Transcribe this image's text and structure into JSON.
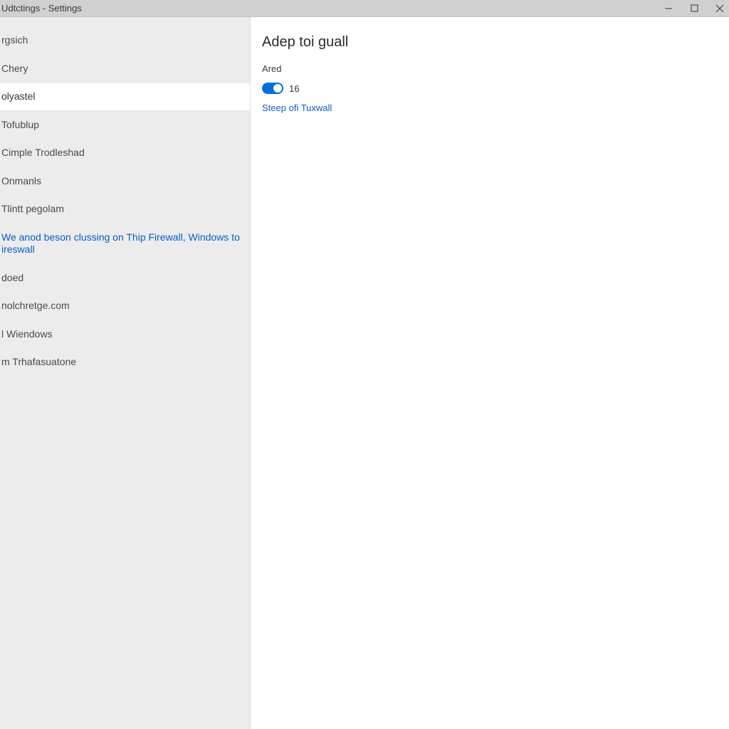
{
  "titlebar": {
    "title": "Udtctings  -  Settings"
  },
  "sidebar": {
    "items": [
      {
        "label": "rgsich",
        "selected": false,
        "link": false
      },
      {
        "label": "Chery",
        "selected": false,
        "link": false
      },
      {
        "label": "olyastel",
        "selected": true,
        "link": false
      },
      {
        "label": "Tofublup",
        "selected": false,
        "link": false
      },
      {
        "label": "Cimple Trodleshad",
        "selected": false,
        "link": false
      },
      {
        "label": "Onmanls",
        "selected": false,
        "link": false
      },
      {
        "label": "Tlintt pegolam",
        "selected": false,
        "link": false
      },
      {
        "label": "We anod beson clussing on Thip Firewall, Windows to ireswall",
        "selected": false,
        "link": true
      },
      {
        "label": "doed",
        "selected": false,
        "link": false
      },
      {
        "label": "nolchretge.com",
        "selected": false,
        "link": false
      },
      {
        "label": "l Wiendows",
        "selected": false,
        "link": false
      },
      {
        "label": "m Trhafasuatone",
        "selected": false,
        "link": false
      }
    ]
  },
  "content": {
    "heading": "Adep toi guall",
    "sub": "Ared",
    "toggle": {
      "on": true,
      "text": "16"
    },
    "link": "Steep ofi Tuxwall"
  },
  "colors": {
    "accent": "#0070d8",
    "link": "#0a5cc4",
    "sidebar_bg": "#ececec",
    "titlebar_bg": "#d0d0d0"
  }
}
